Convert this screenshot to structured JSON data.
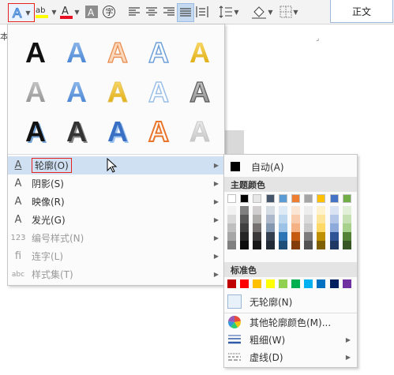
{
  "ribbon": {
    "tab_label": "正文",
    "edge_char": "本",
    "icons": [
      "text-effects-icon",
      "highlight-icon",
      "font-color-icon",
      "char-shading-icon",
      "enclose-char-icon",
      "align-left-icon",
      "align-center-icon",
      "align-right-icon",
      "justify-icon",
      "distribute-icon",
      "line-spacing-icon",
      "shading-icon",
      "borders-icon"
    ]
  },
  "effects_menu": {
    "gallery_glyph": "A",
    "items": [
      {
        "label": "轮廓(O)",
        "icon": "outline-a-icon",
        "has_submenu": true,
        "disabled": false
      },
      {
        "label": "阴影(S)",
        "icon": "shadow-a-icon",
        "has_submenu": true,
        "disabled": false
      },
      {
        "label": "映像(R)",
        "icon": "reflection-a-icon",
        "has_submenu": true,
        "disabled": false
      },
      {
        "label": "发光(G)",
        "icon": "glow-a-icon",
        "has_submenu": true,
        "disabled": false
      },
      {
        "label": "编号样式(N)",
        "icon": "number-style-icon",
        "icon_text": "123",
        "has_submenu": true,
        "disabled": true
      },
      {
        "label": "连字(L)",
        "icon": "ligature-icon",
        "icon_text": "fi",
        "has_submenu": true,
        "disabled": true
      },
      {
        "label": "样式集(T)",
        "icon": "style-set-icon",
        "icon_text": "abc",
        "has_submenu": true,
        "disabled": true
      }
    ]
  },
  "color_submenu": {
    "auto_label": "自动(A)",
    "theme_title": "主题颜色",
    "standard_title": "标准色",
    "no_outline_label": "无轮廓(N)",
    "more_colors_label": "其他轮廓颜色(M)...",
    "weight_label": "粗细(W)",
    "dashes_label": "虚线(D)",
    "theme_top": [
      "#ffffff",
      "#000000",
      "#e7e6e6",
      "#44546a",
      "#5b9bd5",
      "#ed7d31",
      "#a5a5a5",
      "#ffc000",
      "#4472c4",
      "#70ad47"
    ],
    "theme_shades": [
      [
        "#f2f2f2",
        "#d9d9d9",
        "#bfbfbf",
        "#a6a6a6",
        "#808080"
      ],
      [
        "#808080",
        "#595959",
        "#404040",
        "#262626",
        "#0d0d0d"
      ],
      [
        "#d0cece",
        "#aeabab",
        "#757171",
        "#3a3838",
        "#171616"
      ],
      [
        "#d6dce4",
        "#adb9ca",
        "#8497b0",
        "#333f4f",
        "#222a35"
      ],
      [
        "#deebf6",
        "#bdd7ee",
        "#9cc3e5",
        "#2e75b5",
        "#1f4e79"
      ],
      [
        "#fbe5d5",
        "#f7cbac",
        "#f4b183",
        "#c55a11",
        "#833c0b"
      ],
      [
        "#ededed",
        "#dbdbdb",
        "#c9c9c9",
        "#7b7b7b",
        "#525252"
      ],
      [
        "#fff2cc",
        "#fee599",
        "#ffd965",
        "#bf9000",
        "#7f6000"
      ],
      [
        "#dae3f3",
        "#b4c6e7",
        "#8eaadb",
        "#2f5496",
        "#1f3864"
      ],
      [
        "#e2efd9",
        "#c5e0b3",
        "#a8d08d",
        "#538135",
        "#375623"
      ]
    ],
    "standard": [
      "#c00000",
      "#ff0000",
      "#ffc000",
      "#ffff00",
      "#92d050",
      "#00b050",
      "#00b0f0",
      "#0070c0",
      "#002060",
      "#7030a0"
    ]
  }
}
